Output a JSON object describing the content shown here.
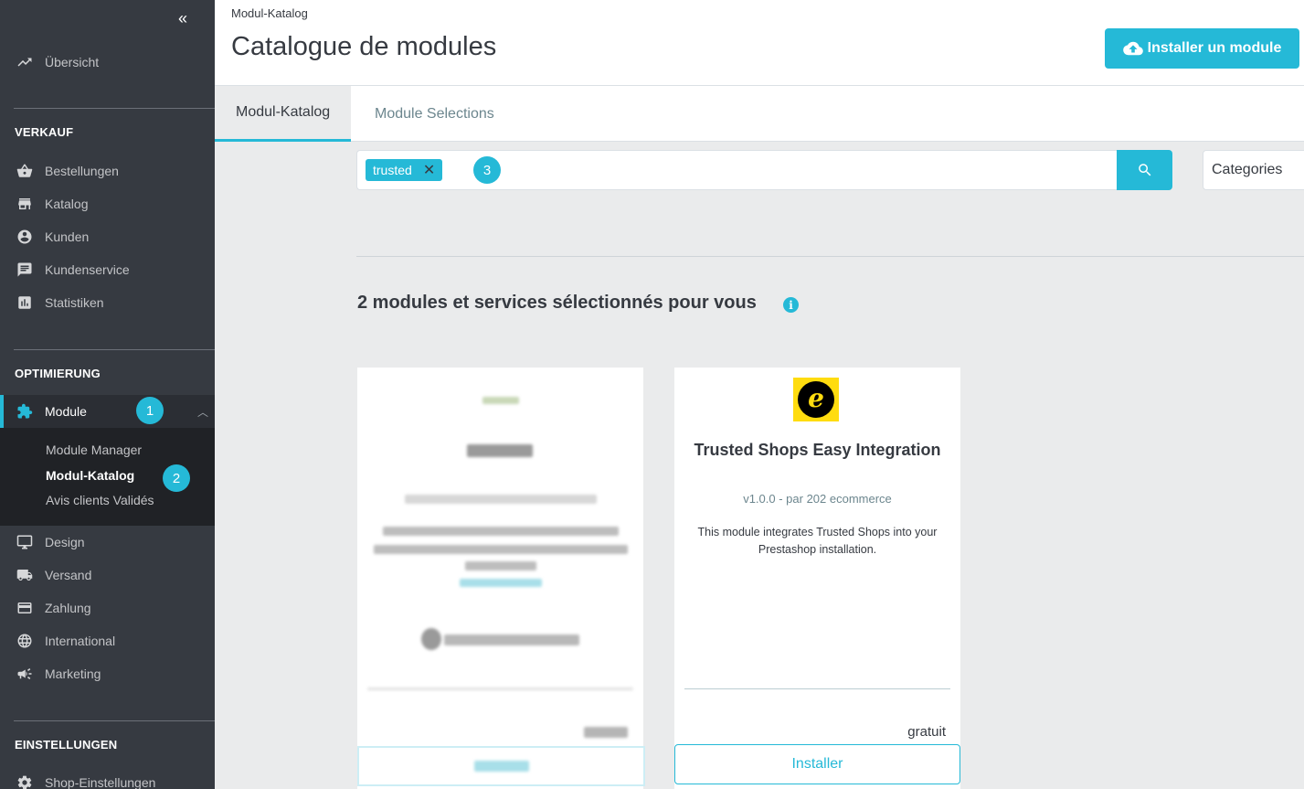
{
  "sidebar": {
    "collapse_icon": "«",
    "overview": "Übersicht",
    "sections": {
      "sales": "VERKAUF",
      "optimization": "OPTIMIERUNG",
      "settings": "EINSTELLUNGEN"
    },
    "sales_items": [
      "Bestellungen",
      "Katalog",
      "Kunden",
      "Kundenservice",
      "Statistiken"
    ],
    "module_label": "Module",
    "module_sub": [
      "Module Manager",
      "Modul-Katalog",
      "Avis clients Validés"
    ],
    "opt_items": [
      "Design",
      "Versand",
      "Zahlung",
      "International",
      "Marketing"
    ],
    "settings_items": [
      "Shop-Einstellungen"
    ],
    "badges": [
      "1",
      "2"
    ]
  },
  "header": {
    "breadcrumb": "Modul-Katalog",
    "title": "Catalogue de modules",
    "install_button": "Installer un module"
  },
  "tabs": [
    "Modul-Katalog",
    "Module Selections"
  ],
  "search": {
    "tag": "trusted",
    "badge": "3",
    "categories": "Categories"
  },
  "results": {
    "title": "2 modules et services sélectionnés pour vous",
    "info_icon": "i"
  },
  "card": {
    "name": "Trusted Shops Easy Integration",
    "version": "v1.0.0 - par 202 ecommerce",
    "description": "This module integrates Trusted Shops into your Prestashop installation.",
    "price": "gratuit",
    "install": "Installer",
    "logo_letter": "e"
  },
  "colors": {
    "accent": "#25b9d7",
    "sidebar_bg": "#363a41",
    "logo_yellow": "#ffdc0f"
  }
}
